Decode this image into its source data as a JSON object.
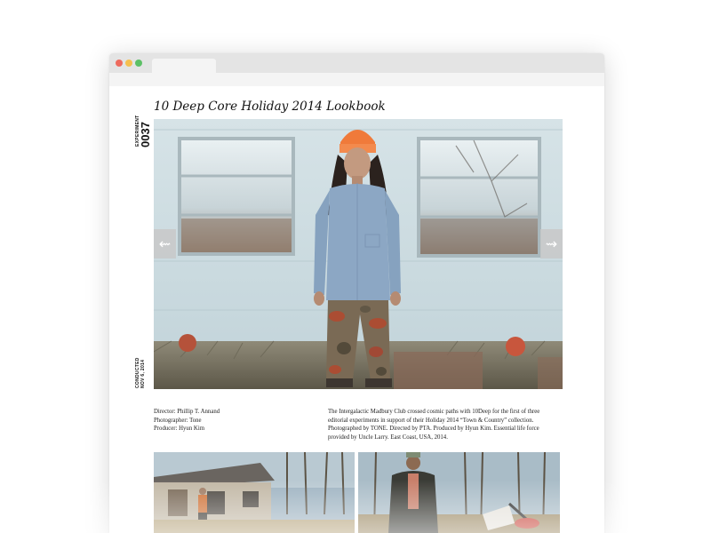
{
  "page": {
    "title": "10 Deep Core Holiday 2014 Lookbook",
    "experiment_label": "EXPERIMENT",
    "experiment_number": "0037",
    "conducted_label": "CONDUCTED",
    "conducted_date": "NOV 6, 2014"
  },
  "slider": {
    "prev_icon": "arrow-left-icon",
    "next_icon": "arrow-right-icon"
  },
  "credits": {
    "director": "Director: Phillip T. Annand",
    "photographer": "Photographer: Tone",
    "producer": "Producer: Hyun Kim"
  },
  "description": "The Intergalactic Madbury Club crossed cosmic paths with 10Deep for the first of three editorial experiments in support of their Holiday 2014 “Town & Country” collection. Photographed by TONE. Directed by PTA. Produced by Hyun Kim. Essential life force provided by Uncle Larry. East Coast, USA, 2014.",
  "colors": {
    "window_chrome": "#e4e4e4",
    "close_dot": "#ee6b5e",
    "minimize_dot": "#f5c04f",
    "maximize_dot": "#5cc066",
    "beanie_orange": "#f07a3a"
  }
}
